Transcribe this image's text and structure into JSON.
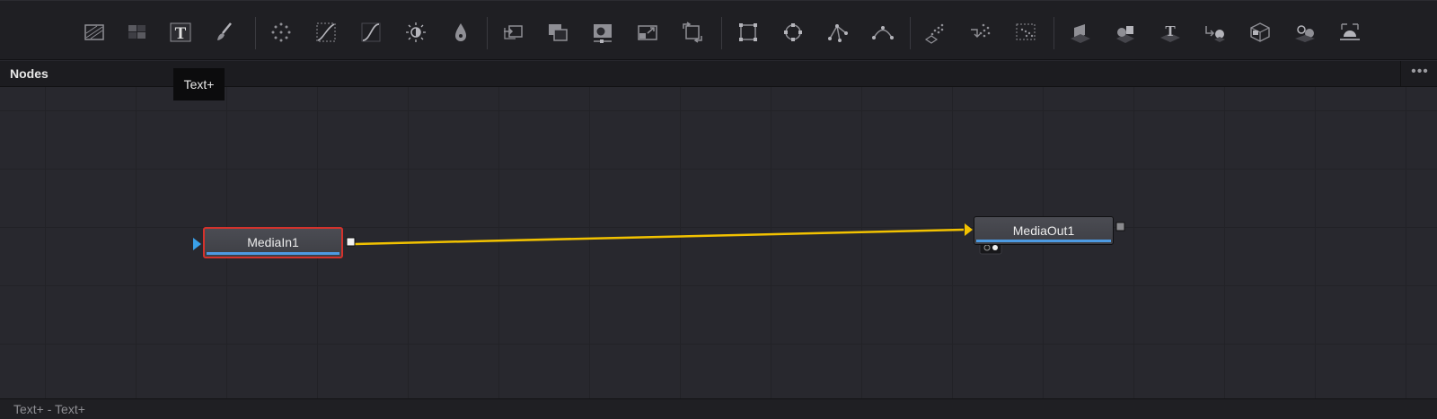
{
  "toolbar": {
    "tools": [
      {
        "name": "background-tool",
        "icon": "background-icon"
      },
      {
        "name": "fast-noise-tool",
        "icon": "fast-noise-icon"
      },
      {
        "name": "text-plus-tool",
        "icon": "text-plus-icon"
      },
      {
        "name": "paint-tool",
        "icon": "paint-brush-icon"
      },
      {
        "name": "particles-tool",
        "icon": "particles-icon"
      },
      {
        "name": "color-curves-tool",
        "icon": "curves-icon"
      },
      {
        "name": "color-corrector-tool",
        "icon": "color-corrector-icon"
      },
      {
        "name": "brightness-contrast-tool",
        "icon": "brightness-contrast-icon"
      },
      {
        "name": "blur-tool",
        "icon": "blur-drop-icon"
      },
      {
        "name": "merge-tool",
        "icon": "merge-icon"
      },
      {
        "name": "channel-booleans-tool",
        "icon": "channel-booleans-icon"
      },
      {
        "name": "matte-control-tool",
        "icon": "matte-control-icon"
      },
      {
        "name": "resize-tool",
        "icon": "resize-icon"
      },
      {
        "name": "transform-tool",
        "icon": "transform-icon"
      },
      {
        "name": "rectangle-mask-tool",
        "icon": "rectangle-mask-icon"
      },
      {
        "name": "ellipse-mask-tool",
        "icon": "ellipse-mask-icon"
      },
      {
        "name": "polygon-mask-tool",
        "icon": "polygon-mask-icon"
      },
      {
        "name": "bspline-mask-tool",
        "icon": "bspline-mask-icon"
      },
      {
        "name": "particle-emitter-tool",
        "icon": "particle-emitter-icon"
      },
      {
        "name": "particle-render-tool",
        "icon": "particle-render-icon"
      },
      {
        "name": "particle-flow-tool",
        "icon": "particle-flow-icon"
      },
      {
        "name": "image-plane-3d-tool",
        "icon": "image-plane-3d-icon"
      },
      {
        "name": "shape-3d-tool",
        "icon": "shape-3d-icon"
      },
      {
        "name": "text-3d-tool",
        "icon": "text-3d-icon"
      },
      {
        "name": "merge-3d-tool",
        "icon": "merge-3d-icon"
      },
      {
        "name": "camera-3d-tool",
        "icon": "camera-3d-icon"
      },
      {
        "name": "renderer-3d-tool",
        "icon": "renderer-3d-icon"
      },
      {
        "name": "spotlight-3d-tool",
        "icon": "spotlight-3d-icon"
      }
    ],
    "tooltip": "Text+"
  },
  "panel": {
    "title": "Nodes",
    "more_icon": "more-options-icon",
    "more_label": "•••"
  },
  "nodes": {
    "media_in": {
      "label": "MediaIn1",
      "selected": true
    },
    "media_out": {
      "label": "MediaOut1"
    }
  },
  "connection": {
    "from": "MediaIn1",
    "to": "MediaOut1",
    "color": "#f2c200"
  },
  "colors": {
    "selection": "#d4322c",
    "node_bar": "#4d9be3",
    "input_arrow_blue": "#3aa0e8",
    "input_arrow_yellow": "#f2c200"
  },
  "status": {
    "text": "Text+ - Text+"
  }
}
